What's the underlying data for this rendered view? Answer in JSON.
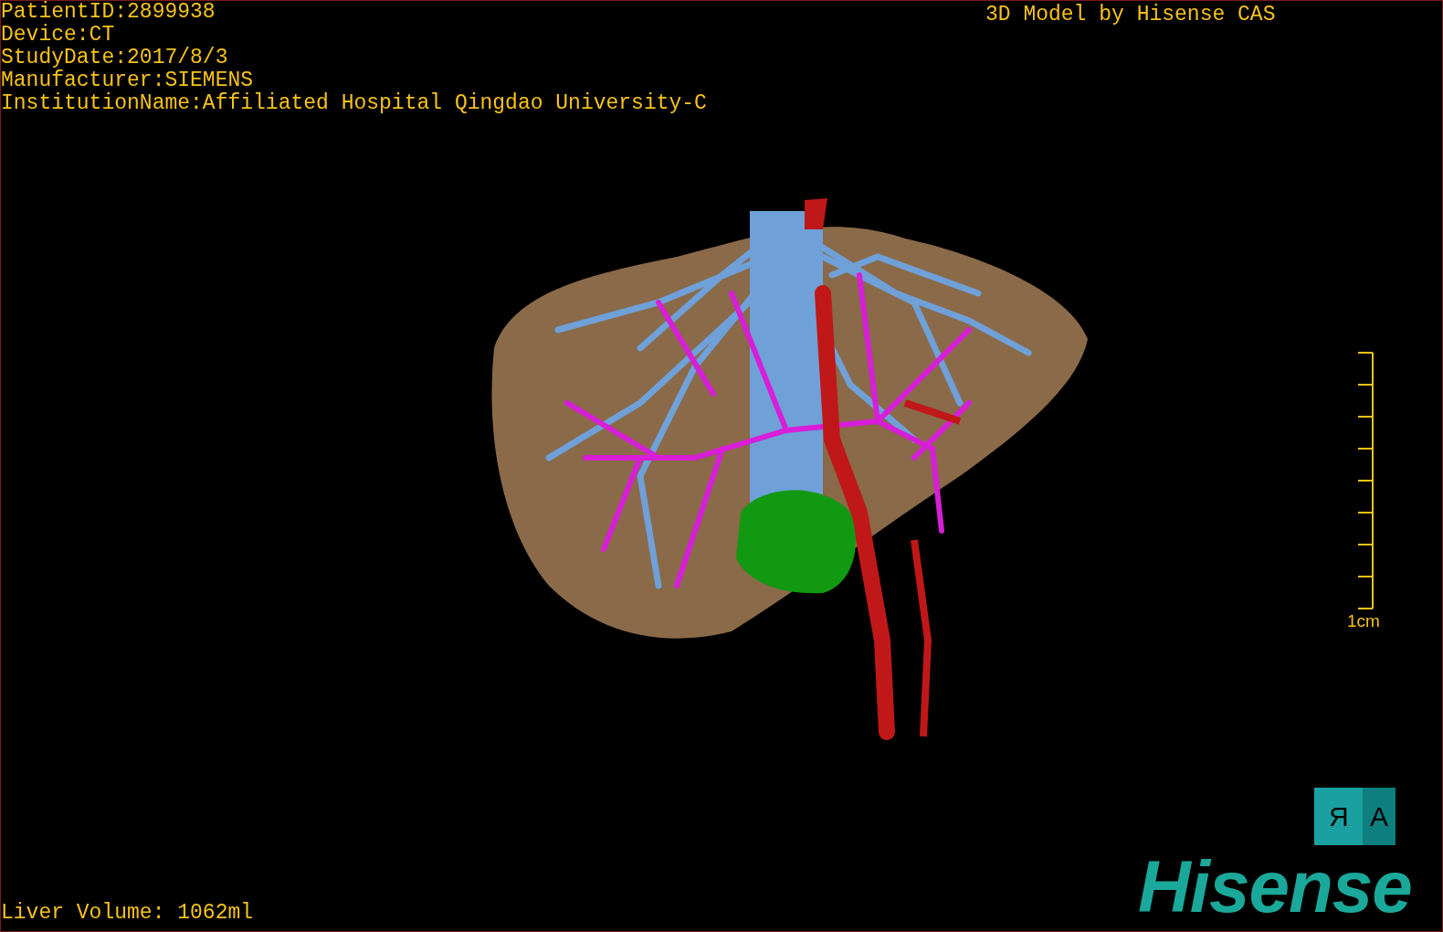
{
  "patient_info": [
    "PatientID:2899938",
    "Device:CT",
    "StudyDate:2017/8/3",
    "Manufacturer:SIEMENS",
    "InstitutionName:Affiliated Hospital Qingdao University-C"
  ],
  "model_caption": "3D Model by Hisense CAS",
  "scale_bar": {
    "label": "1cm"
  },
  "orientation_cube": {
    "faces": [
      {
        "label": "R",
        "mirrored": true
      },
      {
        "label": "A",
        "mirrored": false
      }
    ]
  },
  "liver_volume": "Liver Volume: 1062ml",
  "logo": "Hisense"
}
